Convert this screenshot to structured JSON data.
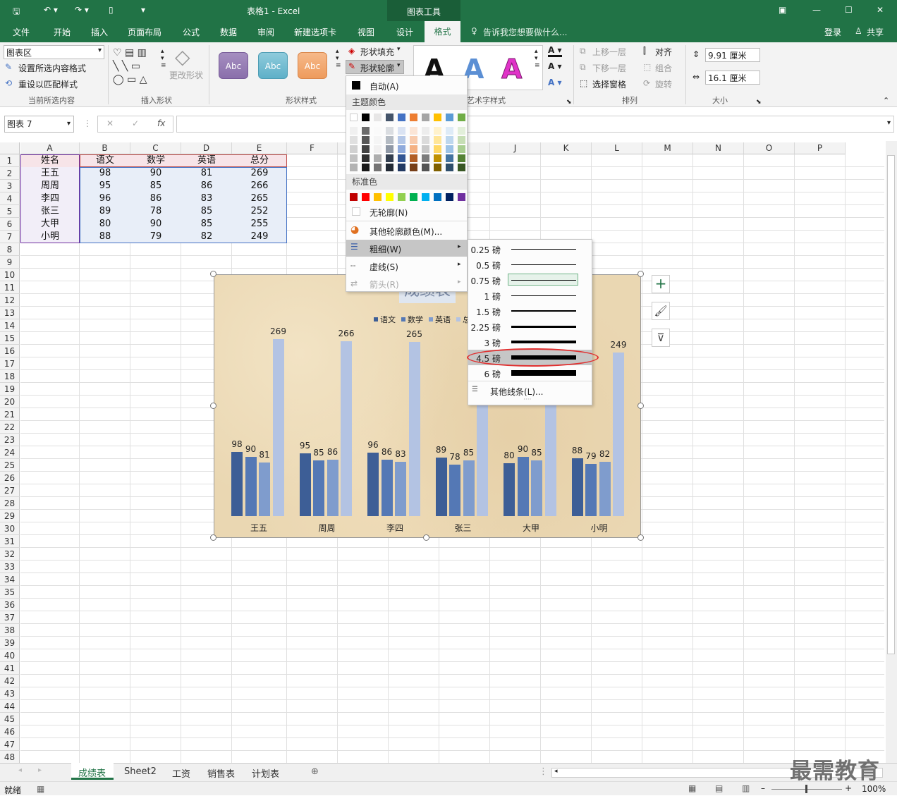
{
  "app": {
    "window_title": "表格1 - Excel",
    "context_title": "图表工具",
    "login": "登录",
    "share": "共享"
  },
  "tabs": [
    "文件",
    "开始",
    "插入",
    "页面布局",
    "公式",
    "数据",
    "审阅",
    "新建选项卡",
    "视图",
    "设计",
    "格式"
  ],
  "active_tab": "格式",
  "tell_me": "告诉我您想要做什么...",
  "ribbon": {
    "current_selection": {
      "dropdown_value": "图表区",
      "format_selection": "设置所选内容格式",
      "reset_style": "重设以匹配样式",
      "group_label": "当前所选内容"
    },
    "insert_shapes": {
      "change_shape": "更改形状",
      "group_label": "插入形状"
    },
    "shape_styles": {
      "abc": "Abc",
      "fill": "形状填充",
      "outline": "形状轮廓",
      "group_label": "形状样式"
    },
    "wordart": {
      "letter": "A",
      "group_label": "艺术字样式"
    },
    "arrange": {
      "bring_forward": "上移一层",
      "send_backward": "下移一层",
      "selection_pane": "选择窗格",
      "align": "对齐",
      "group": "组合",
      "rotate": "旋转",
      "group_label": "排列"
    },
    "size": {
      "height": "9.91 厘米",
      "width": "16.1 厘米",
      "group_label": "大小"
    }
  },
  "formula_bar": {
    "name_box": "图表 7",
    "cancel": "✕",
    "enter": "✓",
    "fx": "fx"
  },
  "columns": [
    "A",
    "B",
    "C",
    "D",
    "E",
    "F",
    "G",
    "H",
    "I",
    "J",
    "K",
    "L",
    "M",
    "N",
    "O",
    "P"
  ],
  "rows": [
    "1",
    "2",
    "3",
    "4",
    "5",
    "6",
    "7",
    "8",
    "9",
    "10",
    "11",
    "12",
    "13",
    "14",
    "15",
    "16",
    "17",
    "18",
    "19",
    "20",
    "21",
    "22",
    "23",
    "24",
    "25",
    "26",
    "27",
    "28",
    "29",
    "30",
    "31",
    "32",
    "33",
    "34",
    "35",
    "36",
    "37",
    "38",
    "39",
    "40",
    "41",
    "42",
    "43",
    "44",
    "45",
    "46",
    "47",
    "48"
  ],
  "table": {
    "headers": [
      "姓名",
      "语文",
      "数学",
      "英语",
      "总分"
    ],
    "rows": [
      [
        "王五",
        "98",
        "90",
        "81",
        "269"
      ],
      [
        "周周",
        "95",
        "85",
        "86",
        "266"
      ],
      [
        "李四",
        "96",
        "86",
        "83",
        "265"
      ],
      [
        "张三",
        "89",
        "78",
        "85",
        "252"
      ],
      [
        "大甲",
        "80",
        "90",
        "85",
        "255"
      ],
      [
        "小明",
        "88",
        "79",
        "82",
        "249"
      ]
    ]
  },
  "chart_data": {
    "type": "bar",
    "title": "成绩表",
    "categories": [
      "王五",
      "周周",
      "李四",
      "张三",
      "大甲",
      "小明"
    ],
    "series": [
      {
        "name": "语文",
        "values": [
          98,
          95,
          96,
          89,
          80,
          88
        ],
        "color": "#3d5e96"
      },
      {
        "name": "数学",
        "values": [
          90,
          85,
          86,
          78,
          90,
          79
        ],
        "color": "#5478b5"
      },
      {
        "name": "英语",
        "values": [
          81,
          86,
          83,
          85,
          85,
          82
        ],
        "color": "#7f9ccd"
      },
      {
        "name": "总分",
        "values": [
          269,
          266,
          265,
          252,
          255,
          249
        ],
        "color": "#b3c3e3"
      }
    ],
    "ylim": [
      0,
      300
    ],
    "grid": false,
    "legend": "top"
  },
  "outline_menu": {
    "auto": "自动(A)",
    "theme_colors": "主题颜色",
    "standard_colors": "标准色",
    "no_outline": "无轮廓(N)",
    "more_colors": "其他轮廓颜色(M)...",
    "weight": "粗细(W)",
    "dashes": "虚线(S)",
    "arrows": "箭头(R)",
    "theme_row": [
      "#ffffff",
      "#000000",
      "#e7e6e6",
      "#44546a",
      "#4472c4",
      "#ed7d31",
      "#a5a5a5",
      "#ffc000",
      "#5b9bd5",
      "#70ad47"
    ],
    "standard_row": [
      "#c00000",
      "#ff0000",
      "#ffc000",
      "#ffff00",
      "#92d050",
      "#00b050",
      "#00b0f0",
      "#0070c0",
      "#002060",
      "#7030a0"
    ]
  },
  "weight_menu": {
    "items": [
      "0.25 磅",
      "0.5 磅",
      "0.75 磅",
      "1 磅",
      "1.5 磅",
      "2.25 磅",
      "3 磅",
      "4.5 磅",
      "6 磅"
    ],
    "weights": [
      0.25,
      0.5,
      0.75,
      1,
      1.5,
      2.25,
      3,
      4.5,
      6
    ],
    "selected": "0.75 磅",
    "hovered": "4.5 磅",
    "more": "其他线条(L)..."
  },
  "sheets": [
    "成绩表",
    "Sheet2",
    "工资",
    "销售表",
    "计划表"
  ],
  "active_sheet": "成绩表",
  "status": {
    "ready": "就绪",
    "zoom": "100%"
  },
  "watermark": "最需教育"
}
